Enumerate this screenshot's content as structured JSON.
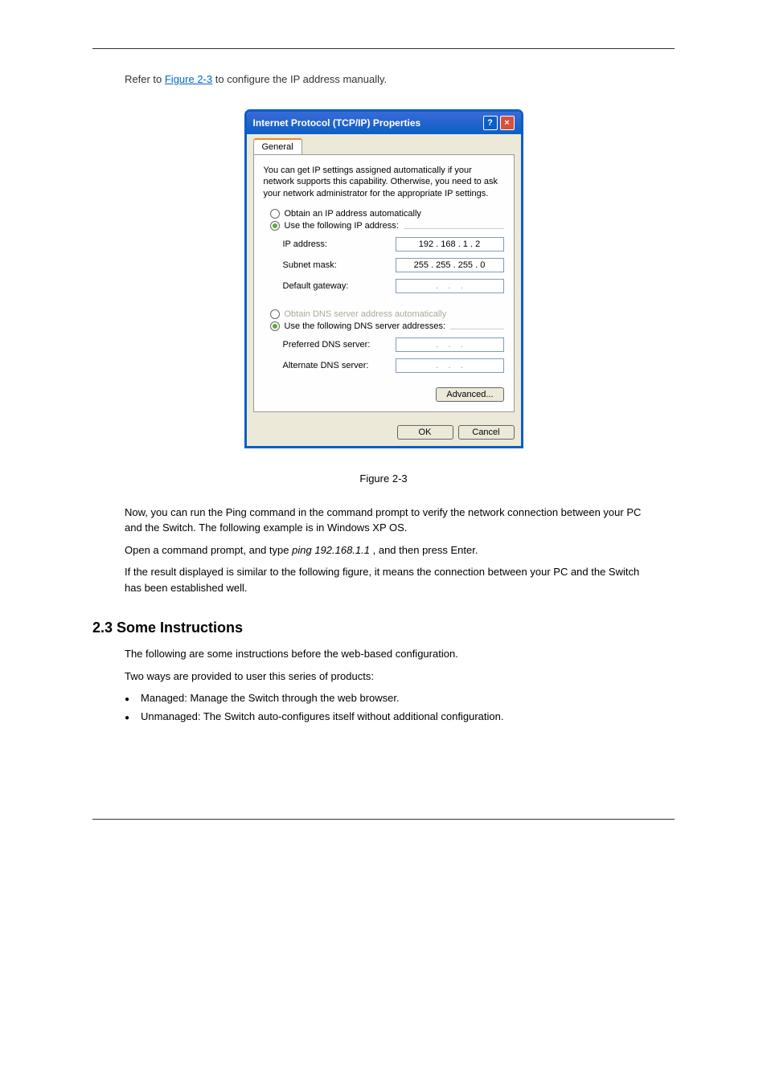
{
  "intro": {
    "text_before": "Refer to ",
    "link": "Figure 2-3",
    "text_after": " to configure the IP address manually."
  },
  "dialog": {
    "title": "Internet Protocol (TCP/IP) Properties",
    "tab": "General",
    "description": "You can get IP settings assigned automatically if your network supports this capability. Otherwise, you need to ask your network administrator for the appropriate IP settings.",
    "radio1": "Obtain an IP address automatically",
    "radio2": "Use the following IP address:",
    "field_ip": "IP address:",
    "field_ip_value": "192 . 168 .  1  .  2",
    "field_mask": "Subnet mask:",
    "field_mask_value": "255 . 255 . 255 .  0",
    "field_gateway": "Default gateway:",
    "radio3": "Obtain DNS server address automatically",
    "radio4": "Use the following DNS server addresses:",
    "field_dns1": "Preferred DNS server:",
    "field_dns2": "Alternate DNS server:",
    "btn_advanced": "Advanced...",
    "btn_ok": "OK",
    "btn_cancel": "Cancel"
  },
  "figure_caption": "Figure 2-3",
  "para1": "Now, you can run the Ping command in the command prompt to verify the network connection between your PC and the Switch. The following example is in Windows XP OS.",
  "para2_a": "Open a command prompt, and type ",
  "para2_cmd": "ping 192.168.1.1",
  "para2_b": ", and then press Enter.",
  "para3": "If the result displayed is similar to the following figure, it means the connection between your PC and the Switch has been established well.",
  "heading": "2.3 Some Instructions",
  "inst_para1": "The following are some instructions before the web-based configuration.",
  "inst_para2": "Two ways are provided to user this series of products:",
  "bullet1": "Managed: Manage the Switch through the web browser.",
  "bullet2": "Unmanaged: The Switch auto-configures itself without additional configuration."
}
